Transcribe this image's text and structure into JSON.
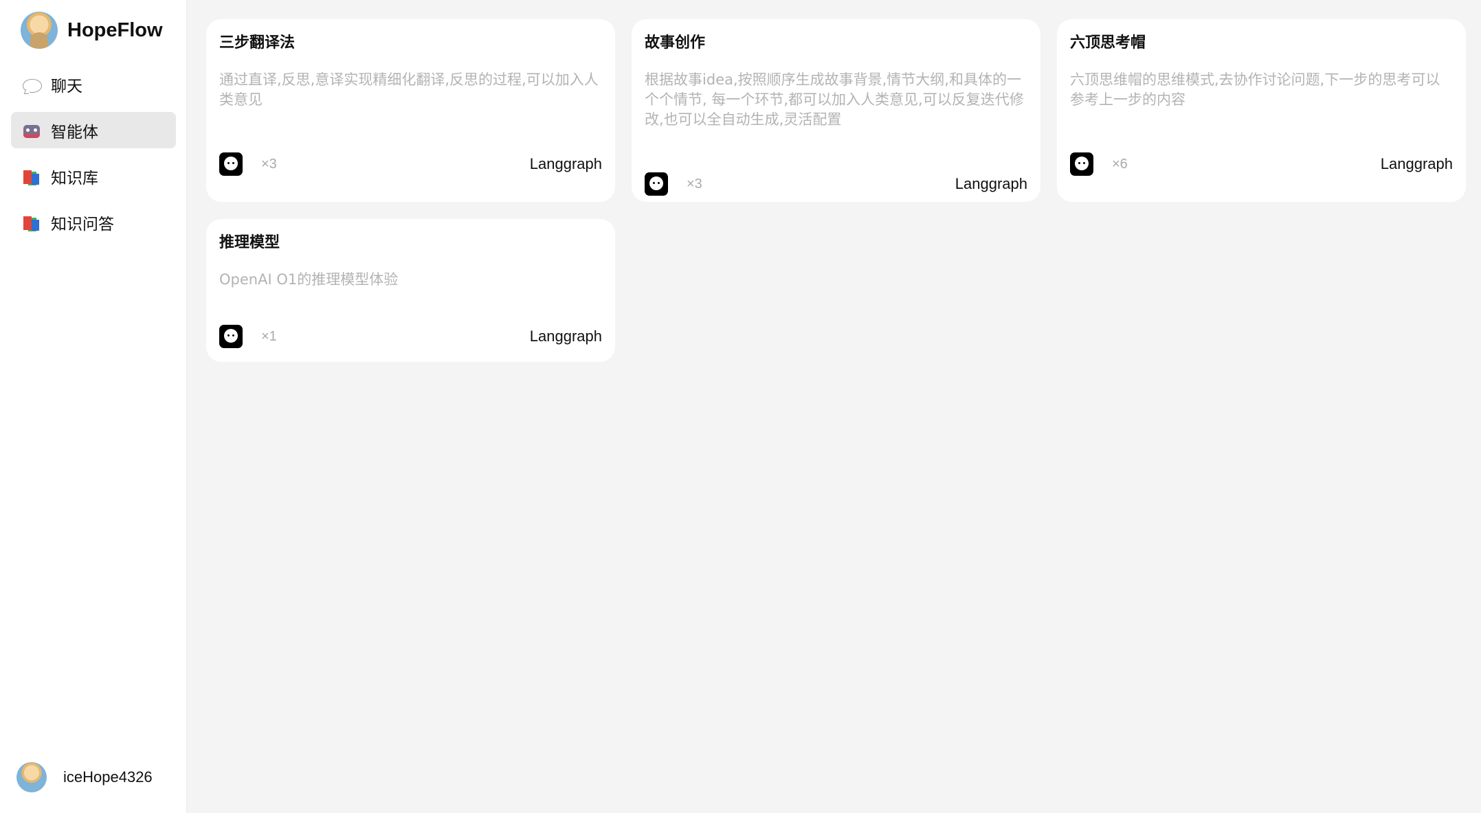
{
  "app": {
    "name": "HopeFlow"
  },
  "sidebar": {
    "items": [
      {
        "label": "聊天",
        "icon": "chat-bubble-icon",
        "active": false
      },
      {
        "label": "智能体",
        "icon": "robot-icon",
        "active": true
      },
      {
        "label": "知识库",
        "icon": "books-icon",
        "active": false
      },
      {
        "label": "知识问答",
        "icon": "books-icon",
        "active": false
      }
    ]
  },
  "user": {
    "name": "iceHope4326"
  },
  "cards": [
    {
      "title": "三步翻译法",
      "description": "通过直译,反思,意译实现精细化翻译,反思的过程,可以加入人类意见",
      "count": "×3",
      "tag": "Langgraph"
    },
    {
      "title": "故事创作",
      "description": "根据故事idea,按照顺序生成故事背景,情节大纲,和具体的一个个情节, 每一个环节,都可以加入人类意见,可以反复迭代修改,也可以全自动生成,灵活配置",
      "count": "×3",
      "tag": "Langgraph"
    },
    {
      "title": "六顶思考帽",
      "description": "六顶思维帽的思维模式,去协作讨论问题,下一步的思考可以参考上一步的内容",
      "count": "×6",
      "tag": "Langgraph"
    },
    {
      "title": "推理模型",
      "description": "OpenAI O1的推理模型体验",
      "count": "×1",
      "tag": "Langgraph"
    }
  ],
  "colors": {
    "page_bg": "#f4f4f4",
    "card_bg": "#ffffff",
    "active_nav_bg": "#e8e8e8",
    "desc_text": "#b3b3b3"
  }
}
